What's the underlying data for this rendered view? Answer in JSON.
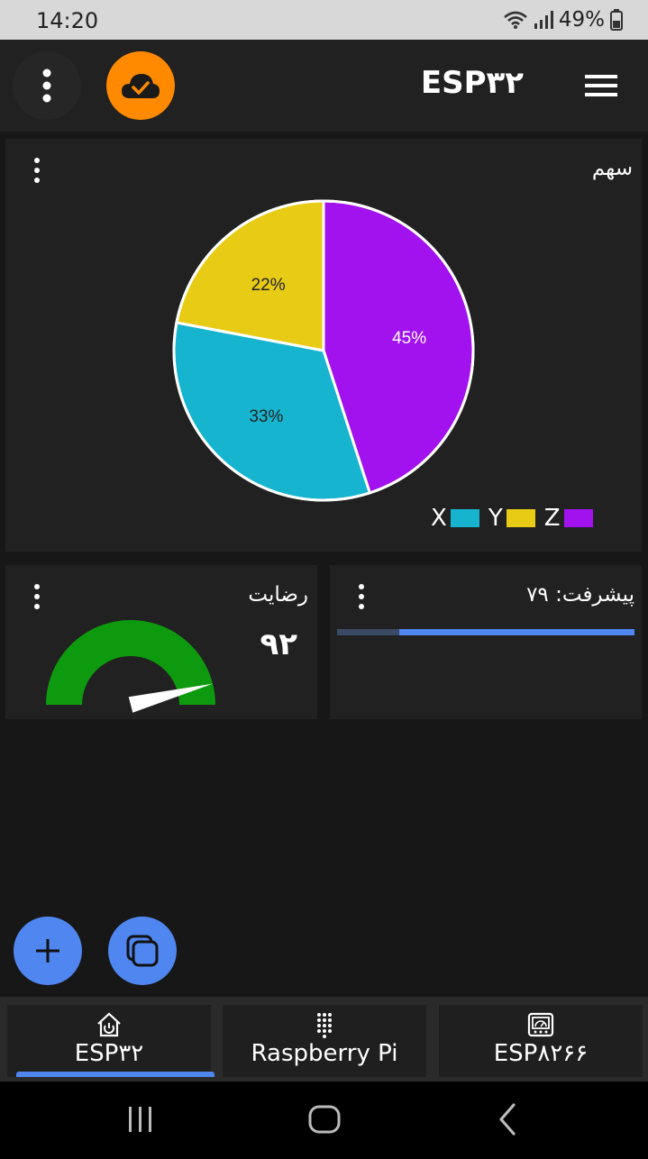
{
  "status": {
    "time": "14:20",
    "battery": "49%"
  },
  "app": {
    "title": "ESP۳۲"
  },
  "pie_card": {
    "title": "سهم"
  },
  "chart_data": {
    "type": "pie",
    "categories": [
      "X",
      "Y",
      "Z"
    ],
    "values": [
      45,
      33,
      22
    ],
    "labels": [
      "45%",
      "33%",
      "22%"
    ],
    "colors": [
      "#a112ee",
      "#16b4cf",
      "#e8cb14"
    ],
    "legend": [
      {
        "label": "X",
        "color": "#16b4cf"
      },
      {
        "label": "Y",
        "color": "#e8cb14"
      },
      {
        "label": "Z",
        "color": "#a112ee"
      }
    ],
    "legend_position": "bottom-right"
  },
  "gauge_card": {
    "title": "رضایت",
    "value": "۹۲",
    "level": 92,
    "max": 100,
    "arc_color": "#0e9a0e"
  },
  "progress_card": {
    "title": "پیشرفت: ۷۹",
    "progress": 79,
    "fill_color": "#4f86f0"
  },
  "tabs": [
    {
      "label": "ESP۳۲",
      "icon": "home-power-icon",
      "active": true
    },
    {
      "label": "Raspberry Pi",
      "icon": "dot-grid-icon",
      "active": false
    },
    {
      "label": "ESP۸۲۶۶",
      "icon": "monitor-gauge-icon",
      "active": false
    }
  ],
  "colors": {
    "accent": "#4f86f0",
    "cloud": "#ff8a00",
    "card": "#212121",
    "background": "#171717"
  }
}
